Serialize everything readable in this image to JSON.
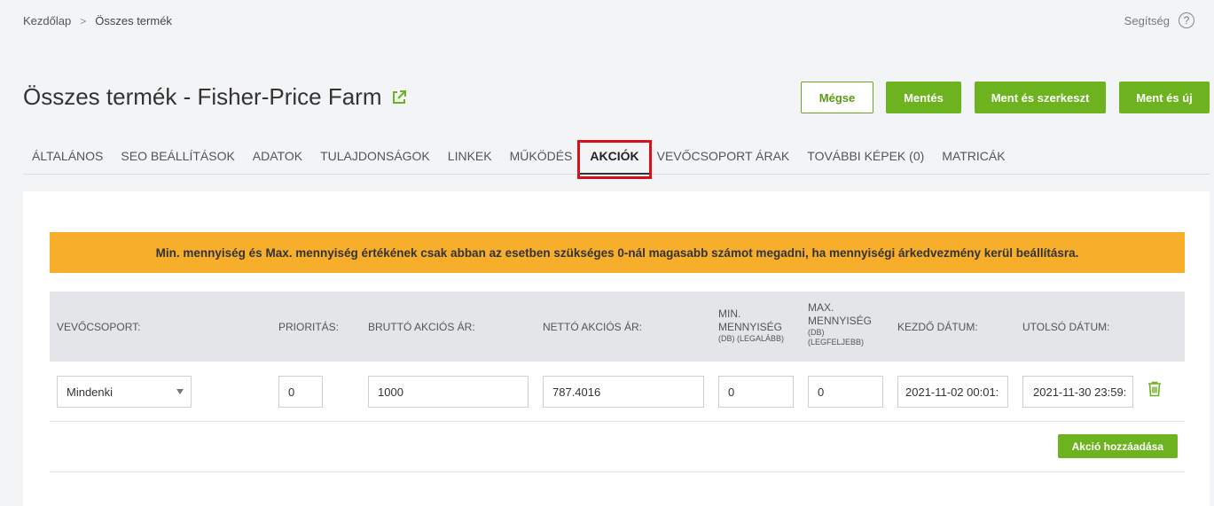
{
  "breadcrumb": {
    "home": "Kezdőlap",
    "separator": ">",
    "current": "Összes termék"
  },
  "help": {
    "label": "Segítség",
    "icon": "?"
  },
  "title": "Összes termék - Fisher-Price Farm",
  "actions": {
    "cancel": "Mégse",
    "save": "Mentés",
    "save_edit": "Ment és szerkeszt",
    "save_new": "Ment és új"
  },
  "tabs": [
    "ÁLTALÁNOS",
    "SEO BEÁLLÍTÁSOK",
    "ADATOK",
    "TULAJDONSÁGOK",
    "LINKEK",
    "MŰKÖDÉS",
    "AKCIÓK",
    "VEVŐCSOPORT ÁRAK",
    "TOVÁBBI KÉPEK (0)",
    "MATRICÁK"
  ],
  "notice": "Min. mennyiség és Max. mennyiség értékének csak abban az esetben szükséges 0-nál magasabb számot megadni, ha mennyiségi árkedvezmény kerül beállításra.",
  "columns": {
    "group": "VEVŐCSOPORT:",
    "priority": "PRIORITÁS:",
    "gross": "BRUTTÓ AKCIÓS ÁR:",
    "net": "NETTÓ AKCIÓS ÁR:",
    "min_l1": "MIN.",
    "min_l2": "MENNYISÉG",
    "min_sub": "(DB) (LEGALÁBB)",
    "max_l1": "MAX.",
    "max_l2": "MENNYISÉG",
    "max_sub1": "(DB)",
    "max_sub2": "(LEGFELJEBB)",
    "start": "KEZDŐ DÁTUM:",
    "end": "UTOLSÓ DÁTUM:"
  },
  "row": {
    "group": "Mindenki",
    "priority": "0",
    "gross": "1000",
    "net": "787.4016",
    "min": "0",
    "max": "0",
    "start": "2021-11-02 00:01:",
    "end": "2021-11-30 23:59:"
  },
  "add_button": "Akció hozzáadása",
  "colors": {
    "accent": "#6db31f",
    "notice": "#f7ae2a",
    "highlight": "#d9101a"
  }
}
